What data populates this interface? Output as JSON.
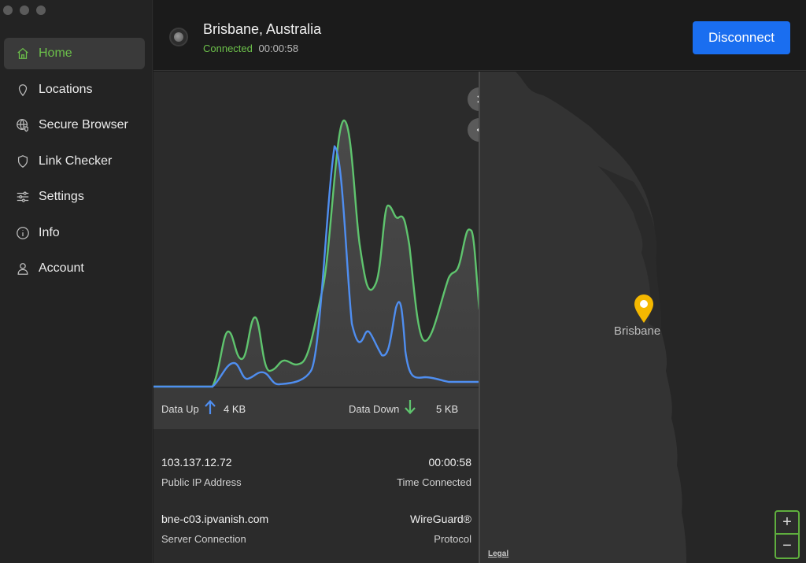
{
  "window": {
    "controls": [
      "close",
      "minimize",
      "zoom"
    ]
  },
  "sidebar": {
    "items": [
      {
        "label": "Home",
        "icon": "home-icon",
        "active": true
      },
      {
        "label": "Locations",
        "icon": "location-pin-icon",
        "active": false
      },
      {
        "label": "Secure Browser",
        "icon": "globe-shield-icon",
        "active": false
      },
      {
        "label": "Link Checker",
        "icon": "shield-icon",
        "active": false
      },
      {
        "label": "Settings",
        "icon": "sliders-icon",
        "active": false
      },
      {
        "label": "Info",
        "icon": "info-icon",
        "active": false
      },
      {
        "label": "Account",
        "icon": "user-icon",
        "active": false
      }
    ]
  },
  "header": {
    "location": "Brisbane, Australia",
    "status": "Connected",
    "elapsed": "00:00:58",
    "disconnect_label": "Disconnect"
  },
  "traffic": {
    "up_label": "Data Up",
    "up_value": "4 KB",
    "down_label": "Data Down",
    "down_value": "5 KB",
    "colors": {
      "up": "#4f8ef0",
      "down": "#5fc46e"
    }
  },
  "details": {
    "ip_value": "103.137.12.72",
    "ip_label": "Public IP Address",
    "time_value": "00:00:58",
    "time_label": "Time Connected",
    "server_value": "bne-c03.ipvanish.com",
    "server_label": "Server Connection",
    "protocol_value": "WireGuard®",
    "protocol_label": "Protocol"
  },
  "map": {
    "pin_label": "Brisbane",
    "legal_label": "Legal",
    "zoom_in_label": "+",
    "zoom_out_label": "−"
  },
  "theme": {
    "accent_green": "#6cc04a",
    "button_blue": "#1a6ef0",
    "pin_yellow": "#f5b800"
  }
}
